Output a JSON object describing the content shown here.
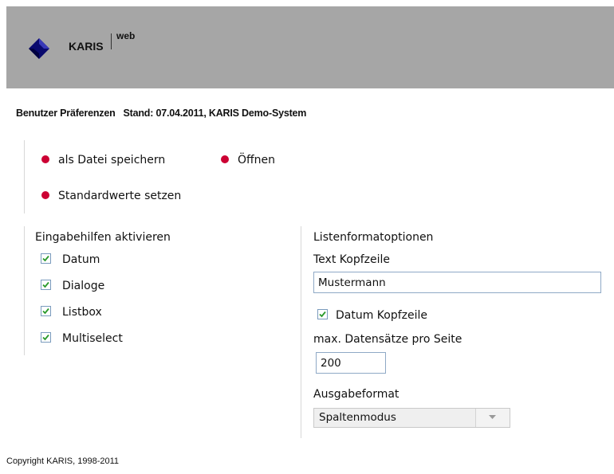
{
  "header": {
    "brand": "KARIS",
    "brand_sub": "web",
    "logo_icon": "diamond-logo-icon",
    "background": "#a6a6a6"
  },
  "page": {
    "title_left": "Benutzer Präferenzen",
    "title_right": "Stand: 07.04.2011, KARIS Demo-System"
  },
  "actions": {
    "save_file": "als Datei speichern",
    "open": "Öffnen",
    "set_defaults": "Standardwerte setzen",
    "bullet_color": "#cc0033"
  },
  "input_aids": {
    "title": "Eingabehilfen aktivieren",
    "items": [
      {
        "label": "Datum",
        "checked": true
      },
      {
        "label": "Dialoge",
        "checked": true
      },
      {
        "label": "Listbox",
        "checked": true
      },
      {
        "label": "Multiselect",
        "checked": true
      }
    ]
  },
  "list_format": {
    "title": "Listenformatoptionen",
    "header_text_label": "Text Kopfzeile",
    "header_text_value": "Mustermann",
    "date_header_label": "Datum Kopfzeile",
    "date_header_checked": true,
    "max_records_label": "max. Datensätze pro Seite",
    "max_records_value": "200",
    "output_format_label": "Ausgabeformat",
    "output_format_value": "Spaltenmodus"
  },
  "footer": {
    "copyright": "Copyright KARIS, 1998-2011"
  }
}
